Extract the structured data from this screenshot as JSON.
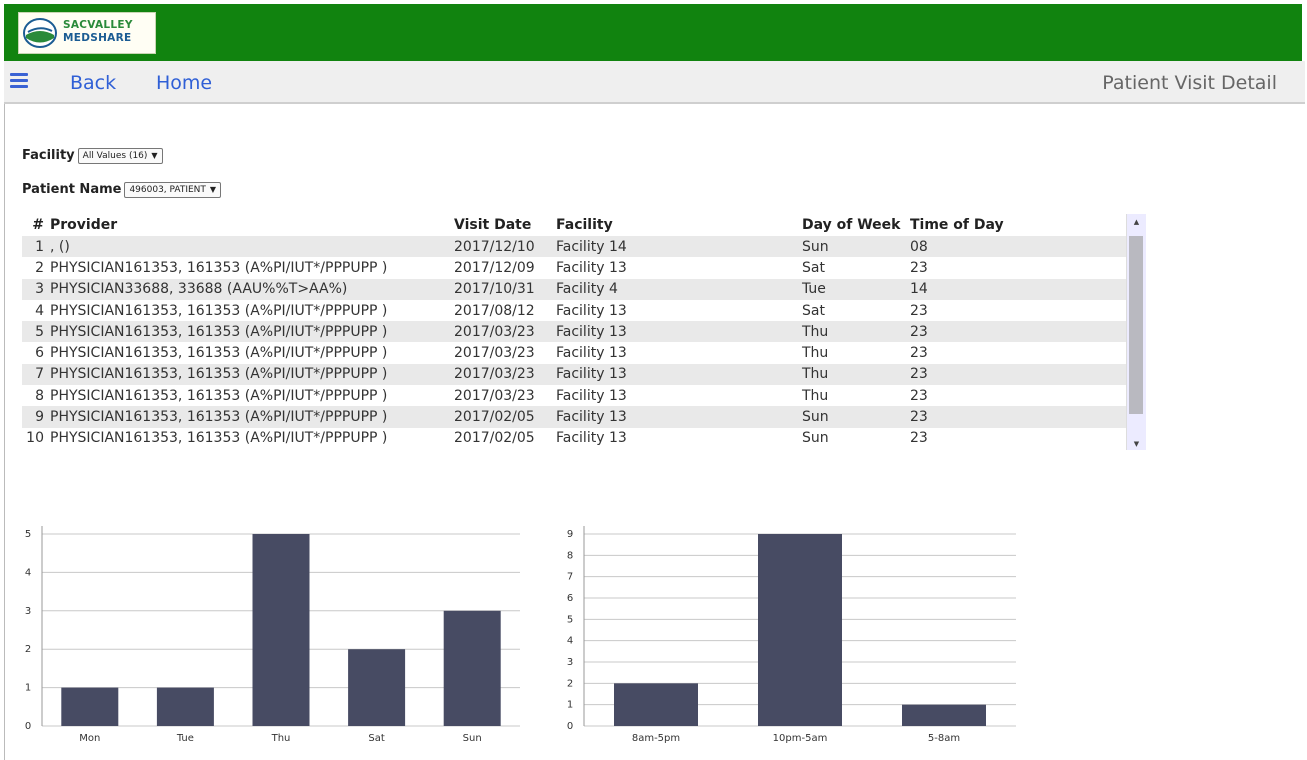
{
  "header": {
    "logo_line1": "SACVALLEY",
    "logo_line2": "MEDSHARE"
  },
  "nav": {
    "back_label": "Back",
    "home_label": "Home",
    "page_title": "Patient Visit Detail"
  },
  "filters": {
    "facility": {
      "label": "Facility",
      "value": "All Values (16)"
    },
    "patient_name": {
      "label": "Patient Name",
      "value": "496003, PATIENT"
    }
  },
  "table": {
    "columns": [
      "#",
      "Provider",
      "Visit Date",
      "Facility",
      "Day of Week",
      "Time of Day"
    ],
    "rows": [
      [
        "1",
        ", ()",
        "2017/12/10",
        "Facility 14",
        "Sun",
        "08"
      ],
      [
        "2",
        "PHYSICIAN161353, 161353 (A%PI/IUT*/PPPUPP )",
        "2017/12/09",
        "Facility 13",
        "Sat",
        "23"
      ],
      [
        "3",
        "PHYSICIAN33688, 33688 (AAU%%T>AA%)",
        "2017/10/31",
        "Facility 4",
        "Tue",
        "14"
      ],
      [
        "4",
        "PHYSICIAN161353, 161353 (A%PI/IUT*/PPPUPP )",
        "2017/08/12",
        "Facility 13",
        "Sat",
        "23"
      ],
      [
        "5",
        "PHYSICIAN161353, 161353 (A%PI/IUT*/PPPUPP )",
        "2017/03/23",
        "Facility 13",
        "Thu",
        "23"
      ],
      [
        "6",
        "PHYSICIAN161353, 161353 (A%PI/IUT*/PPPUPP )",
        "2017/03/23",
        "Facility 13",
        "Thu",
        "23"
      ],
      [
        "7",
        "PHYSICIAN161353, 161353 (A%PI/IUT*/PPPUPP )",
        "2017/03/23",
        "Facility 13",
        "Thu",
        "23"
      ],
      [
        "8",
        "PHYSICIAN161353, 161353 (A%PI/IUT*/PPPUPP )",
        "2017/03/23",
        "Facility 13",
        "Thu",
        "23"
      ],
      [
        "9",
        "PHYSICIAN161353, 161353 (A%PI/IUT*/PPPUPP )",
        "2017/02/05",
        "Facility 13",
        "Sun",
        "23"
      ],
      [
        "10",
        "PHYSICIAN161353, 161353 (A%PI/IUT*/PPPUPP )",
        "2017/02/05",
        "Facility 13",
        "Sun",
        "23"
      ]
    ]
  },
  "colors": {
    "header_green": "#11830f",
    "nav_link_blue": "#2f5fd6",
    "bar_fill": "#474b63"
  },
  "chart_data": [
    {
      "type": "bar",
      "categories": [
        "Mon",
        "Tue",
        "Thu",
        "Sat",
        "Sun"
      ],
      "values": [
        1,
        1,
        5,
        2,
        3
      ],
      "title": "",
      "xlabel": "",
      "ylabel": "",
      "ylim": [
        0,
        5
      ],
      "yticks": [
        0,
        1,
        2,
        3,
        4,
        5
      ],
      "grid": true
    },
    {
      "type": "bar",
      "categories": [
        "8am-5pm",
        "10pm-5am",
        "5-8am"
      ],
      "values": [
        2,
        9,
        1
      ],
      "title": "",
      "xlabel": "",
      "ylabel": "",
      "ylim": [
        0,
        9
      ],
      "yticks": [
        0,
        1,
        2,
        3,
        4,
        5,
        6,
        7,
        8,
        9
      ],
      "grid": true
    }
  ]
}
